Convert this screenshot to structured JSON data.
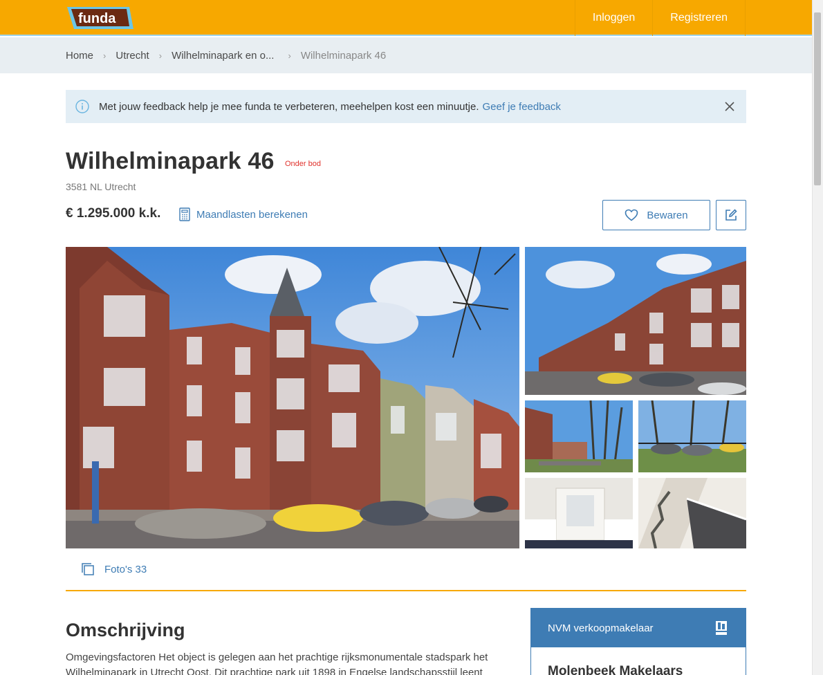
{
  "header": {
    "logo_text": "funda",
    "nav": [
      {
        "label": "Inloggen"
      },
      {
        "label": "Registreren"
      }
    ]
  },
  "breadcrumb": {
    "items": [
      "Home",
      "Utrecht",
      "Wilhelminapark en o..."
    ],
    "current": "Wilhelminapark 46"
  },
  "banner": {
    "text": "Met jouw feedback help je mee funda te verbeteren, meehelpen kost een minuutje.",
    "link": "Geef je feedback",
    "icon": "info-icon"
  },
  "listing": {
    "title": "Wilhelminapark 46",
    "status": "Onder bod",
    "address": "3581 NL Utrecht",
    "price": "€ 1.295.000 k.k.",
    "calc_link": "Maandlasten berekenen",
    "save_label": "Bewaren"
  },
  "photos": {
    "label": "Foto's 33"
  },
  "description": {
    "heading": "Omschrijving",
    "text": "Omgevingsfactoren Het object is gelegen aan het prachtige rijksmonumentale stadspark het Wilhelminapark in Utrecht Oost. Dit prachtige park uit 1898 in Engelse landschapsstijl leent"
  },
  "agent": {
    "heading": "NVM verkoopmakelaar",
    "name": "Molenbeek Makelaars"
  },
  "colors": {
    "brand": "#f7a800",
    "link": "#3e7cb4",
    "status": "#e0312b"
  }
}
